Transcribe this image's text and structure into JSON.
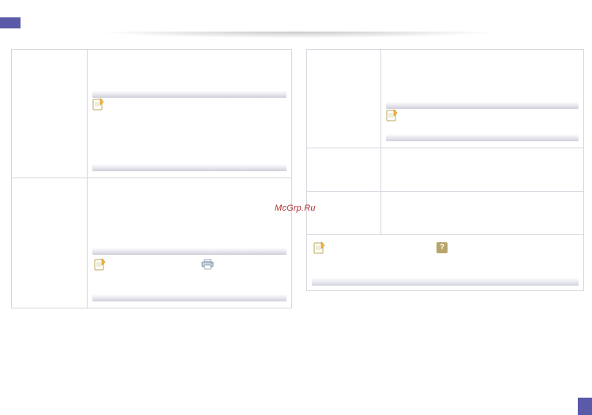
{
  "watermark": "McGrp.Ru",
  "icons": {
    "note": "note-icon",
    "printer": "printer-icon",
    "help": "help-icon"
  }
}
